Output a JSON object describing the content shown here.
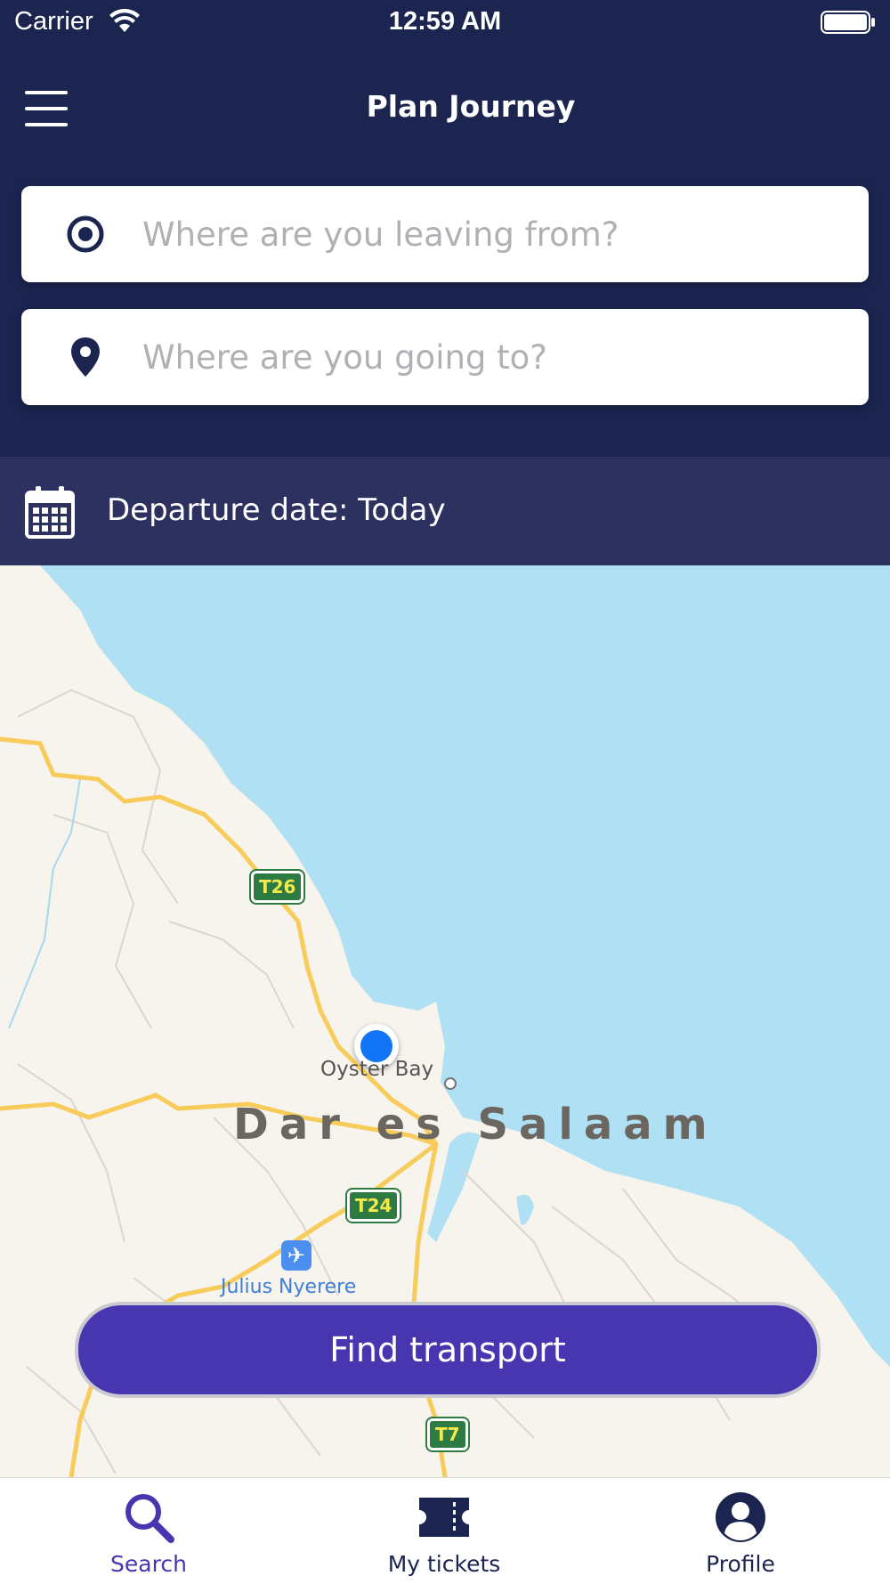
{
  "status_bar": {
    "carrier": "Carrier",
    "time": "12:59 AM"
  },
  "header": {
    "title": "Plan Journey"
  },
  "search": {
    "from_placeholder": "Where are you leaving from?",
    "to_placeholder": "Where are you going to?"
  },
  "departure": {
    "label": "Departure date: Today"
  },
  "map": {
    "labels": {
      "oyster_bay": "Oyster Bay",
      "city": "Dar es Salaam",
      "airport": "Julius Nyerere"
    },
    "road_badges": [
      "T26",
      "T24",
      "T7"
    ],
    "colors": {
      "water": "#b0e0f3",
      "land": "#f7f3ed",
      "road": "#f8cc5a"
    }
  },
  "actions": {
    "find_transport": "Find transport"
  },
  "tabs": [
    {
      "label": "Search",
      "icon": "search-icon",
      "active": true
    },
    {
      "label": "My tickets",
      "icon": "ticket-icon",
      "active": false
    },
    {
      "label": "Profile",
      "icon": "profile-icon",
      "active": false
    }
  ],
  "theme": {
    "primary": "#1b2550",
    "accent": "#4836b0",
    "date_bar": "#2c3160"
  }
}
